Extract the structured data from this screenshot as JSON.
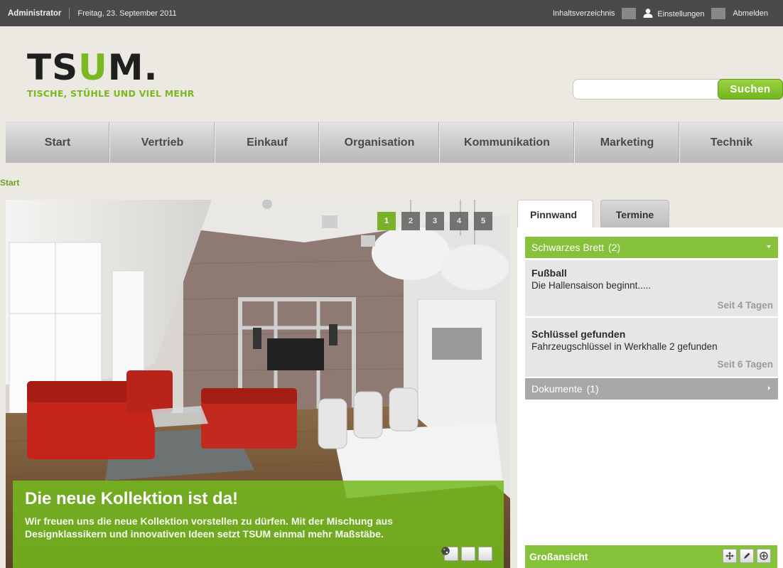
{
  "topbar": {
    "user": "Administrator",
    "date": "Freitag, 23. September 2011",
    "links": [
      "Inhaltsverzeichnis",
      "Einstellungen",
      "Abmelden"
    ]
  },
  "logo": {
    "text_pre": "TS",
    "text_u": "U",
    "text_post": "M.",
    "tagline": "TISCHE, STÜHLE UND VIEL MEHR"
  },
  "search": {
    "placeholder": "",
    "value": "",
    "button": "Suchen"
  },
  "nav": [
    "Start",
    "Vertrieb",
    "Einkauf",
    "Organisation",
    "Kommunikation",
    "Marketing",
    "Technik"
  ],
  "breadcrumb": "Start",
  "hero": {
    "pages": [
      "1",
      "2",
      "3",
      "4",
      "5"
    ],
    "active_page": 1,
    "headline": "Die neue Kollektion ist da!",
    "text_line1": "Wir freuen uns die neue Kollektion vorstellen zu dürfen. Mit der Mischung aus",
    "text_line2": "Designklassikern und innovativen Ideen setzt TSUM einmal mehr Maßstäbe."
  },
  "tabs": [
    "Pinnwand",
    "Termine"
  ],
  "board": {
    "title": "Schwarzes Brett",
    "count": "(2)",
    "entries": [
      {
        "title": "Fußball",
        "text": "Die Hallensaison beginnt.....",
        "age": "Seit 4 Tagen"
      },
      {
        "title": "Schlüssel gefunden",
        "text": "Fahrzeugschlüssel in Werkhalle 2 gefunden",
        "age": "Seit 6 Tagen"
      }
    ]
  },
  "documents": {
    "title": "Dokumente",
    "count": "(1)"
  },
  "bigview": {
    "label": "Großansicht"
  },
  "colors": {
    "accent": "#86c13a",
    "topbar": "#4a4a4a",
    "background": "#ece8e2"
  }
}
